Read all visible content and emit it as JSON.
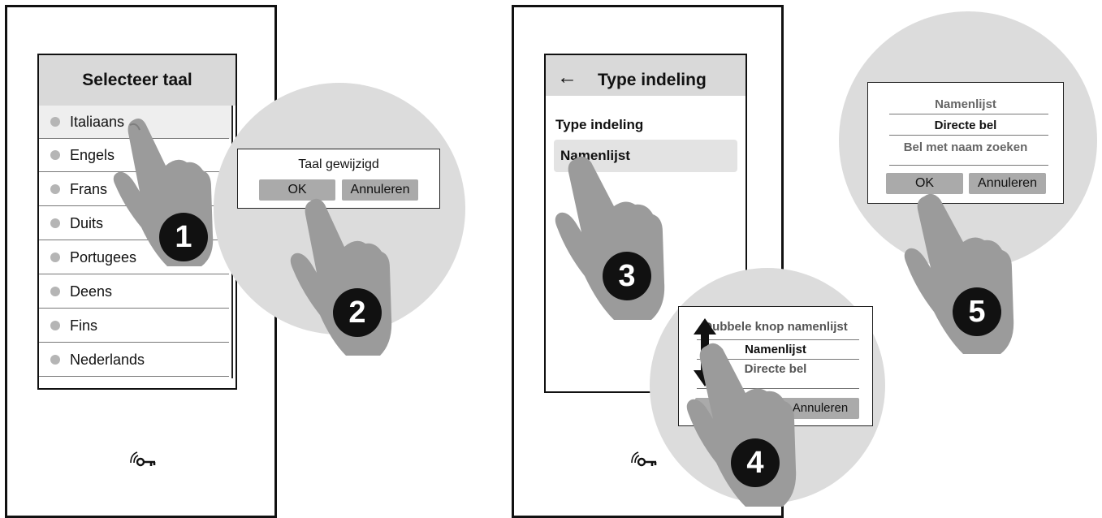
{
  "panel_left": {
    "title": "Selecteer taal",
    "languages": [
      "Italiaans",
      "Engels",
      "Frans",
      "Duits",
      "Portugees",
      "Deens",
      "Fins",
      "Nederlands"
    ],
    "dialog": {
      "message": "Taal gewijzigd",
      "ok": "OK",
      "cancel": "Annuleren"
    }
  },
  "panel_right": {
    "back_arrow": "←",
    "title": "Type indeling",
    "setting_label": "Type indeling",
    "setting_value": "Namenlijst",
    "dialog4": {
      "title": "Dubbele knop namenlijst",
      "option1": "Namenlijst",
      "option2": "Directe bel",
      "ok": "OK",
      "cancel": "Annuleren"
    },
    "dialog5": {
      "option1": "Namenlijst",
      "option2": "Directe bel",
      "option3": "Bel met naam zoeken",
      "ok": "OK",
      "cancel": "Annuleren"
    }
  },
  "steps": [
    "1",
    "2",
    "3",
    "4",
    "5"
  ],
  "icons": {
    "device_icon": "wireless-key-icon",
    "hand": "pointing-hand-icon",
    "scroll": "up-down-arrow-icon"
  }
}
